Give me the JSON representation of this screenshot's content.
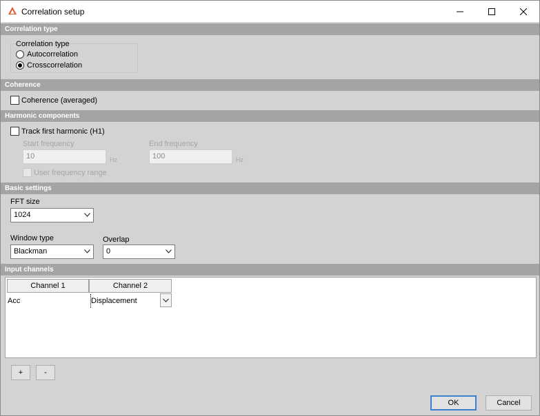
{
  "window": {
    "title": "Correlation setup"
  },
  "correlation_type": {
    "header": "Correlation type",
    "group_label": "Correlation type",
    "options": [
      {
        "label": "Autocorrelation",
        "checked": false
      },
      {
        "label": "Crosscorrelation",
        "checked": true
      }
    ]
  },
  "coherence": {
    "header": "Coherence",
    "checkbox_label": "Coherence (averaged)",
    "checked": false
  },
  "harmonic": {
    "header": "Harmonic components",
    "track_label": "Track first harmonic (H1)",
    "track_checked": false,
    "start_label": "Start frequency",
    "start_value": "10",
    "start_unit": "Hz",
    "end_label": "End frequency",
    "end_value": "100",
    "end_unit": "Hz",
    "user_range_label": "User frequency range"
  },
  "basic": {
    "header": "Basic settings",
    "fft_label": "FFT size",
    "fft_value": "1024",
    "window_label": "Window type",
    "window_value": "Blackman",
    "overlap_label": "Overlap",
    "overlap_value": "0"
  },
  "input_channels": {
    "header": "Input channels",
    "columns": [
      "Channel 1",
      "Channel 2"
    ],
    "rows": [
      {
        "ch1": "Acc",
        "ch2": "Displacement"
      }
    ]
  },
  "buttons": {
    "add": "+",
    "remove": "-",
    "ok": "OK",
    "cancel": "Cancel"
  },
  "colors": {
    "section_header": "#a4a3a5",
    "panel": "#d4d3d4",
    "default_button_border": "#3c7fd1",
    "app_icon": "#e8532b"
  }
}
